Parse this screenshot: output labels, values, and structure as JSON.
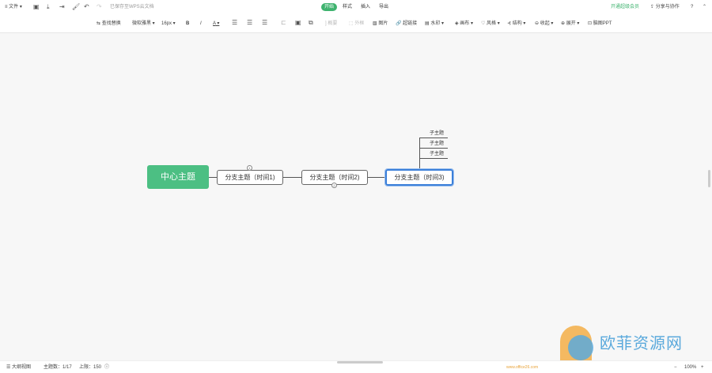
{
  "topbar": {
    "file": "文件",
    "saved": "已保存至WPS云文档",
    "tabs": [
      "开始",
      "样式",
      "插入",
      "导出"
    ],
    "vip": "开通超级会员",
    "share": "分享与协作",
    "help": "?"
  },
  "toolbar": {
    "find": "查找替换",
    "font": "微软雅黑",
    "size": "16px",
    "bold": "B",
    "italic": "I",
    "font_color": "A",
    "summary": "概要",
    "frame": "外框",
    "image": "图片",
    "link": "超链接",
    "watermark": "水印",
    "canvas": "画布",
    "style": "风格",
    "structure": "结构",
    "collapse": "收起",
    "expand": "展开",
    "ppt": "脑图PPT"
  },
  "mindmap": {
    "center": "中心主题",
    "branches": [
      "分支主题（时间1)",
      "分支主题（时间2)",
      "分支主题（时间3)"
    ],
    "subtopics": [
      "子主题",
      "子主题",
      "子主题"
    ],
    "badge1": "1",
    "badge2": "2"
  },
  "status": {
    "outline": "大纲视图",
    "topics": "主题数：1/17",
    "limit": "上限：150",
    "zoom": "100%",
    "minus": "−",
    "plus": "+"
  },
  "watermark": {
    "text": "欧菲资源网",
    "url": "www.office26.com"
  }
}
